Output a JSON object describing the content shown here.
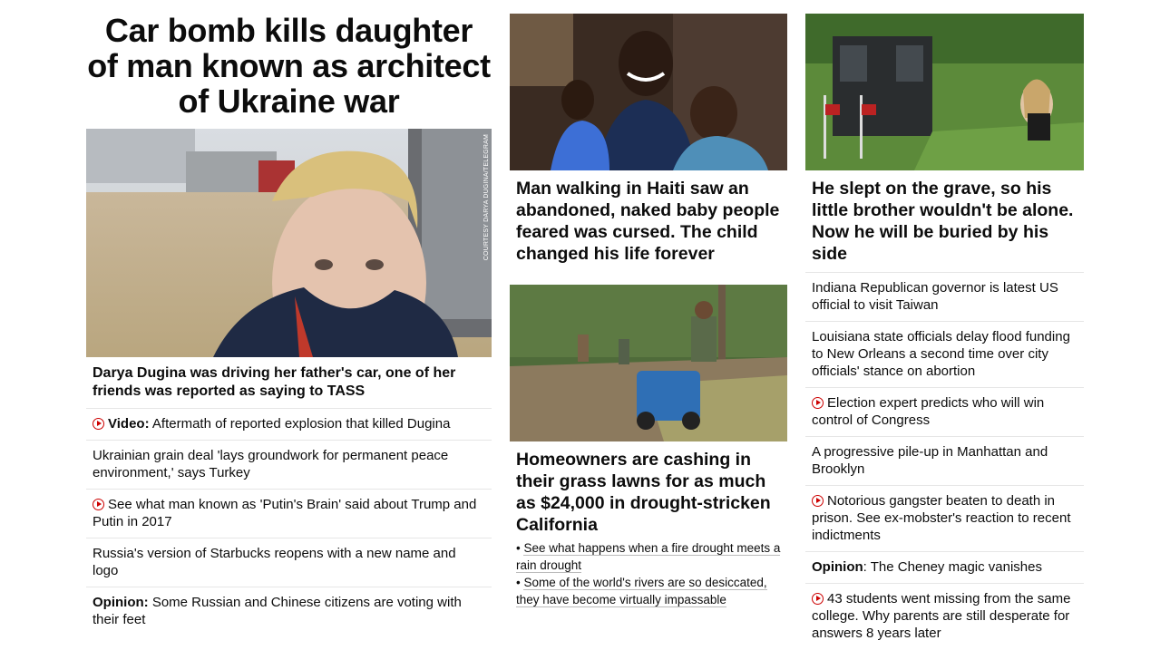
{
  "col1": {
    "headline": "Car bomb kills daughter of man known as architect of Ukraine war",
    "image_credit": "COURTESY DARYA DUGINA/TELEGRAM",
    "caption": "Darya Dugina was driving her father's car, one of her friends was reported as saying to TASS",
    "items": [
      {
        "video": true,
        "prefix": "Video:",
        "text": " Aftermath of reported explosion that killed Dugina"
      },
      {
        "video": false,
        "prefix": "",
        "text": "Ukrainian grain deal 'lays groundwork for permanent peace environment,' says Turkey"
      },
      {
        "video": true,
        "prefix": "",
        "text": "See what man known as 'Putin's Brain' said about Trump and Putin in 2017"
      },
      {
        "video": false,
        "prefix": "",
        "text": "Russia's version of Starbucks reopens with a new name and logo"
      },
      {
        "video": false,
        "prefix": "Opinion:",
        "text": " Some Russian and Chinese citizens are voting with their feet"
      }
    ]
  },
  "col2": {
    "story1": {
      "headline": "Man walking in Haiti saw an abandoned, naked baby people feared was cursed. The child changed his life forever"
    },
    "story2": {
      "headline": "Homeowners are cashing in their grass lawns for as much as $24,000 in drought-stricken California",
      "links": [
        "See what happens when a fire drought meets a rain drought",
        "Some of the world's rivers are so desiccated, they have become virtually impassable"
      ]
    }
  },
  "col3": {
    "headline": "He slept on the grave, so his little brother wouldn't be alone. Now he will be buried by his side",
    "items": [
      {
        "video": false,
        "prefix": "",
        "text": "Indiana Republican governor is latest US official to visit Taiwan"
      },
      {
        "video": false,
        "prefix": "",
        "text": "Louisiana state officials delay flood funding to New Orleans a second time over city officials' stance on abortion"
      },
      {
        "video": true,
        "prefix": "",
        "text": "Election expert predicts who will win control of Congress"
      },
      {
        "video": false,
        "prefix": "",
        "text": "A progressive pile-up in Manhattan and Brooklyn"
      },
      {
        "video": true,
        "prefix": "",
        "text": "Notorious gangster beaten to death in prison. See ex-mobster's reaction to recent indictments"
      },
      {
        "video": false,
        "prefix": "Opinion",
        "text": ": The Cheney magic vanishes"
      },
      {
        "video": true,
        "prefix": "",
        "text": "43 students went missing from the same college. Why parents are still desperate for answers 8 years later"
      }
    ]
  },
  "colors": {
    "accent": "#cc0000",
    "text": "#0c0c0c",
    "divider": "#e6e6e6"
  },
  "icons": {
    "video": "play-circle-icon"
  }
}
